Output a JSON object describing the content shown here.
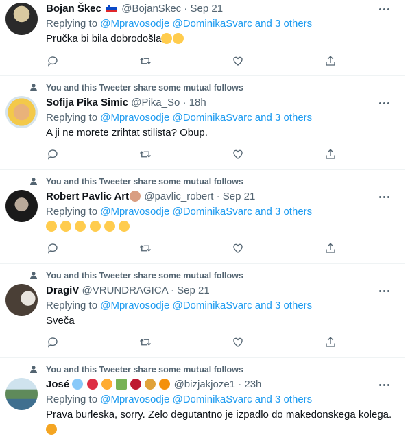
{
  "social_context": "You and this Tweeter share some mutual follows",
  "replying_prefix": "Replying to",
  "mention_1": "@Mpravosodje",
  "mention_2": "@DominikaSvarc",
  "and_others": "and 3 others",
  "tweets": [
    {
      "name": "Bojan Škec",
      "handle": "@BojanSkec",
      "sep": "·",
      "time": "Sep 21",
      "text": "Pručka bi bila dobrodošla"
    },
    {
      "name": "Sofija Pika Simic",
      "handle": "@Pika_So",
      "sep": "·",
      "time": "18h",
      "text": "A ji ne morete zrihtat stilista? Obup."
    },
    {
      "name": "Robert Pavlic Art",
      "handle": "@pavlic_robert",
      "sep": "·",
      "time": "Sep 21",
      "text": ""
    },
    {
      "name": "DragiV",
      "handle": "@VRUNDRAGICA",
      "sep": "·",
      "time": "Sep 21",
      "text": "Sveča"
    },
    {
      "name": "José",
      "handle": "@bizjakjoze1",
      "sep": "·",
      "time": "23h",
      "text": "Prava burleska, sorry. Zelo degutantno je izpadlo do makedonskega kolega."
    }
  ],
  "icons": [
    "reply-icon",
    "retweet-icon",
    "like-icon",
    "share-icon",
    "more-icon",
    "person-icon"
  ],
  "colors": {
    "link": "#1d9bf0",
    "secondary": "#536471",
    "text": "#0f1419"
  }
}
